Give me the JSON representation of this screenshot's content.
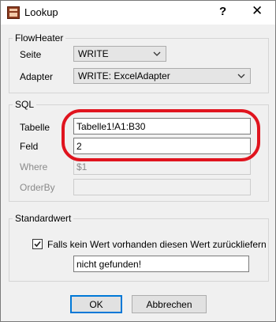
{
  "window": {
    "title": "Lookup",
    "help_label": "?",
    "close_label": "✕"
  },
  "flowheater": {
    "legend": "FlowHeater",
    "seite_label": "Seite",
    "seite_value": "WRITE",
    "adapter_label": "Adapter",
    "adapter_value": "WRITE: ExcelAdapter"
  },
  "sql": {
    "legend": "SQL",
    "tabelle_label": "Tabelle",
    "tabelle_value": "Tabelle1!A1:B30",
    "feld_label": "Feld",
    "feld_value": "2",
    "where_label": "Where",
    "where_value": "$1",
    "orderby_label": "OrderBy",
    "orderby_value": ""
  },
  "standardwert": {
    "legend": "Standardwert",
    "checkbox_label": "Falls kein Wert vorhanden diesen Wert zurückliefern",
    "checked": true,
    "default_value": "nicht gefunden!"
  },
  "buttons": {
    "ok": "OK",
    "cancel": "Abbrechen"
  },
  "colors": {
    "highlight": "#e0141e",
    "accent": "#0078d7"
  },
  "icons": [
    "app-icon",
    "help-icon",
    "close-icon",
    "chevron-down-icon",
    "checkmark-icon"
  ]
}
